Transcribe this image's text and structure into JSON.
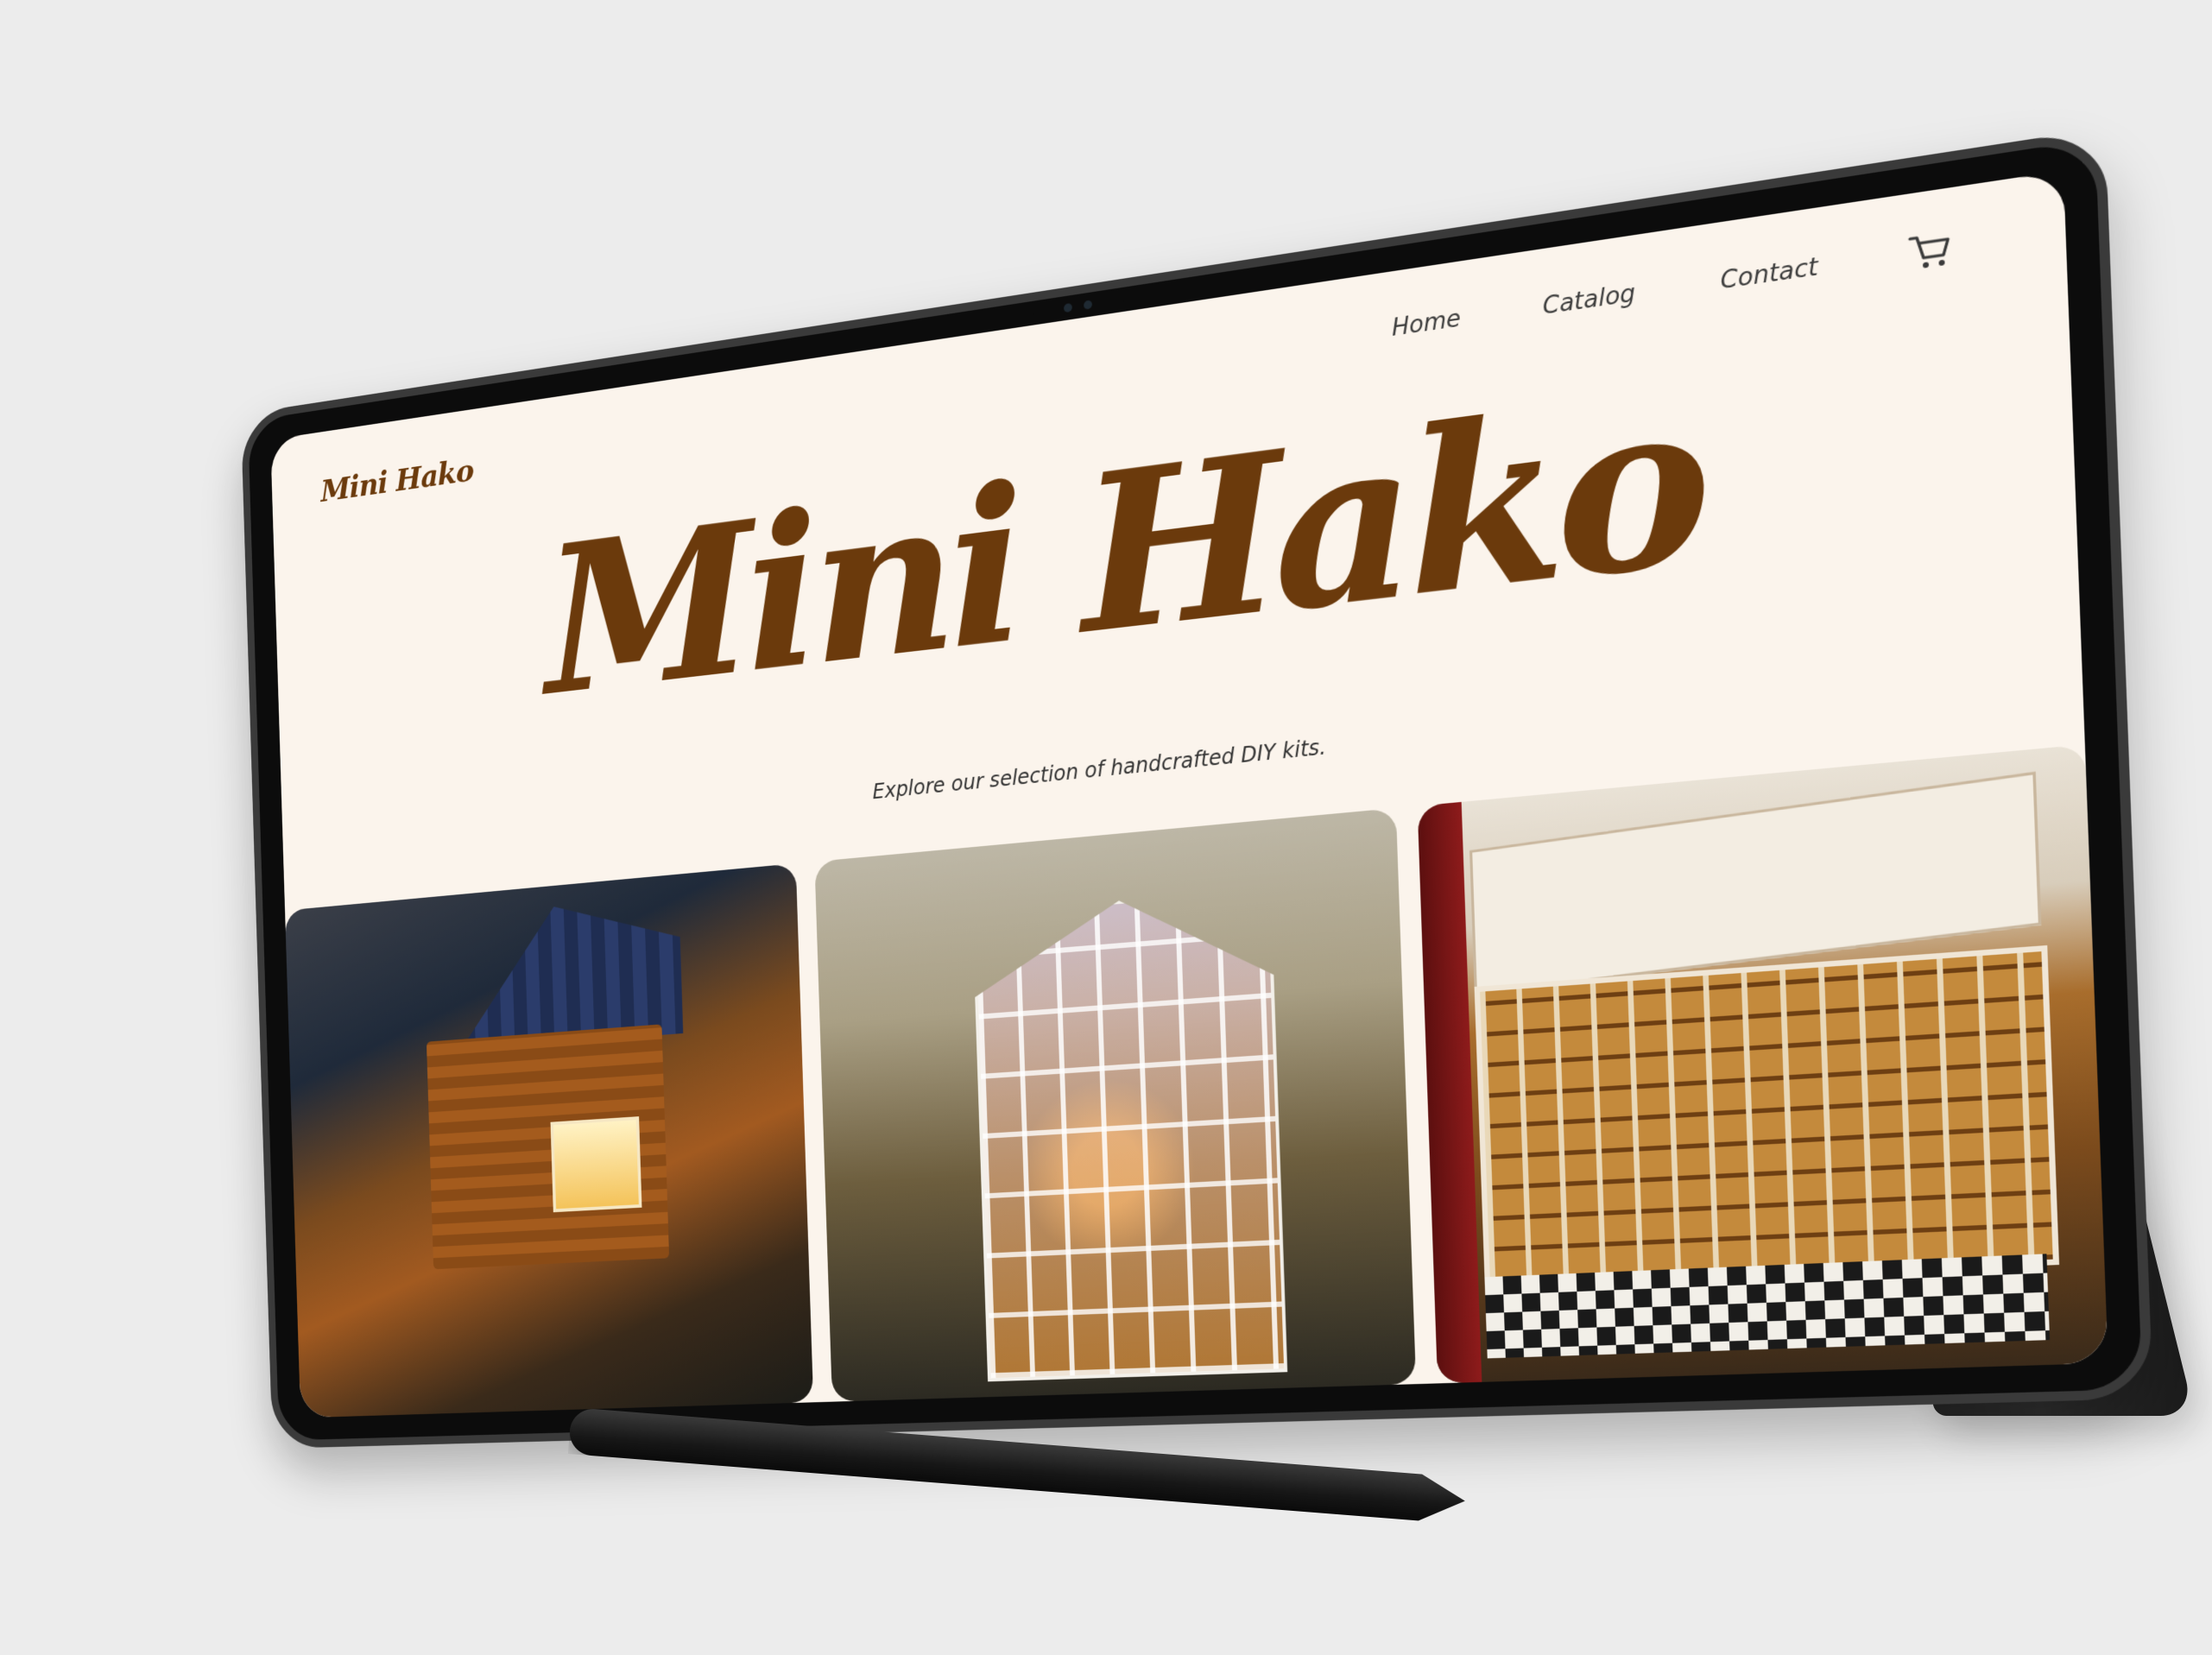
{
  "site": {
    "logo": "Mini Hako",
    "hero_title": "Mini Hako",
    "hero_subtitle": "Explore our selection of handcrafted DIY kits."
  },
  "nav": {
    "links": [
      {
        "label": "Home"
      },
      {
        "label": "Catalog"
      },
      {
        "label": "Contact"
      }
    ],
    "cart_icon": "shopping-cart-icon"
  },
  "gallery": {
    "items": [
      {
        "name": "treehouse-kit"
      },
      {
        "name": "greenhouse-book-nook"
      },
      {
        "name": "library-book-nook"
      }
    ]
  },
  "colors": {
    "brand_brown": "#6b3a0c",
    "page_background": "#fbf4ec",
    "text_dark": "#333333"
  }
}
